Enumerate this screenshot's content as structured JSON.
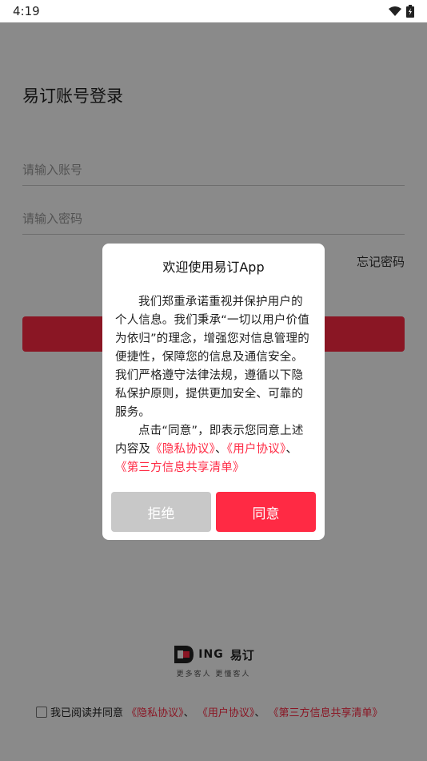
{
  "status_bar": {
    "time": "4:19",
    "icons": [
      "wifi-icon",
      "battery-icon"
    ]
  },
  "login": {
    "title": "易订账号登录",
    "account_placeholder": "请输入账号",
    "password_placeholder": "请输入密码",
    "forgot_password": "忘记密码"
  },
  "brand": {
    "latin": "ING",
    "name": "易订",
    "slogan": "更多客人  更懂客人"
  },
  "agreement": {
    "prefix": "我已阅读并同意",
    "privacy": "《隐私协议》",
    "sep1": "、",
    "user": "《用户协议》",
    "sep2": "、",
    "third_party": "《第三方信息共享清单》"
  },
  "dialog": {
    "title": "欢迎使用易订App",
    "paragraph1": "我们郑重承诺重视并保护用户的个人信息。我们秉承“一切以用户价值为依归”的理念，增强您对信息管理的便捷性，保障您的信息及通信安全。我们严格遵守法律法规，遵循以下隐私保护原则，提供更加安全、可靠的服务。",
    "paragraph2_prefix": "点击“同意”，即表示您同意上述内容及",
    "privacy": "《隐私协议》",
    "sep1": "、",
    "user": "《用户协议》",
    "sep2": "、",
    "third_party": "《第三方信息共享清单》",
    "reject": "拒绝",
    "agree": "同意"
  },
  "colors": {
    "accent": "#ff2a44",
    "reject_button": "#c8c8c8",
    "overlay": "rgba(0,0,0,0.46)"
  }
}
